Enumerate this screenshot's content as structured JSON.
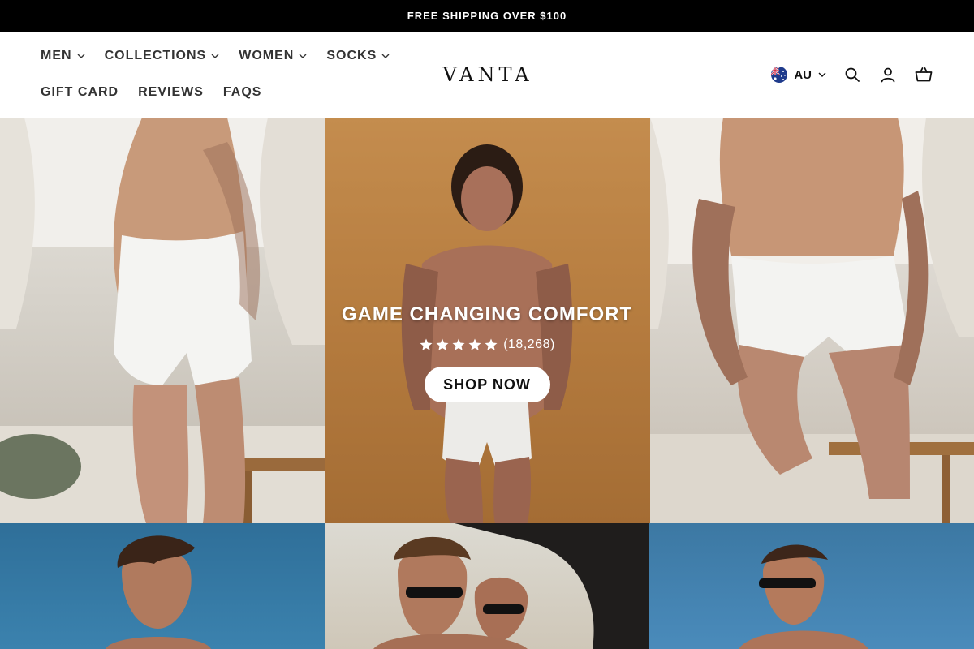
{
  "announcement": "FREE SHIPPING OVER $100",
  "nav": {
    "row1": [
      {
        "label": "MEN",
        "has_dropdown": true
      },
      {
        "label": "COLLECTIONS",
        "has_dropdown": true
      },
      {
        "label": "WOMEN",
        "has_dropdown": true
      },
      {
        "label": "SOCKS",
        "has_dropdown": true
      }
    ],
    "row2": [
      {
        "label": "GIFT CARD"
      },
      {
        "label": "REVIEWS"
      },
      {
        "label": "FAQS"
      }
    ]
  },
  "logo": "VANTA",
  "locale": {
    "code": "AU",
    "flag": "australia-flag-icon"
  },
  "header_icons": [
    "search-icon",
    "account-icon",
    "cart-icon"
  ],
  "hero": {
    "title": "GAME CHANGING COMFORT",
    "rating": {
      "stars": 5,
      "count": "(18,268)"
    },
    "cta": "SHOP NOW"
  },
  "colors": {
    "announcement_bg": "#000000",
    "hero_text": "#ffffff",
    "button_bg": "#ffffff"
  }
}
